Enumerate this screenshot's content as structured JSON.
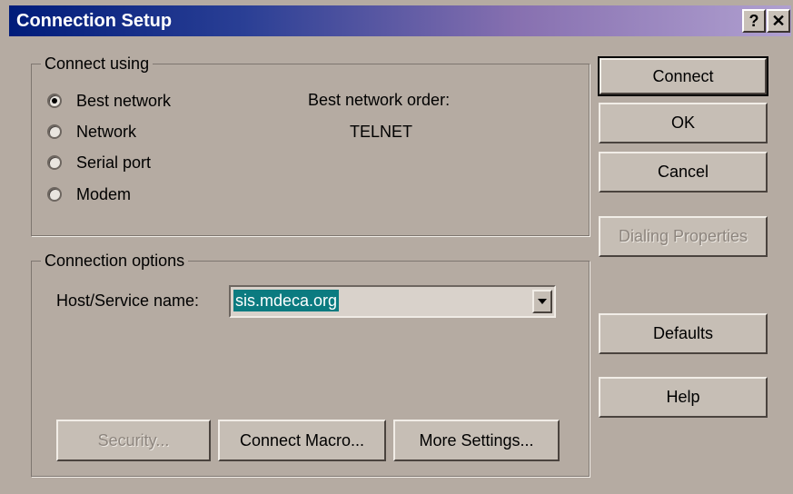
{
  "window": {
    "title": "Connection Setup"
  },
  "caption_buttons": {
    "help": "?",
    "close": "✕"
  },
  "connect_using": {
    "label": "Connect using",
    "options": [
      {
        "label": "Best network",
        "selected": true
      },
      {
        "label": "Network",
        "selected": false
      },
      {
        "label": "Serial port",
        "selected": false
      },
      {
        "label": "Modem",
        "selected": false
      }
    ],
    "order_label": "Best network order:",
    "order_value": "TELNET"
  },
  "connection_options": {
    "label": "Connection options",
    "host_label": "Host/Service name:",
    "host_value": "sis.mdeca.org"
  },
  "bottom_buttons": {
    "security": "Security...",
    "connect_macro": "Connect Macro...",
    "more_settings": "More Settings..."
  },
  "side_buttons": {
    "connect": "Connect",
    "ok": "OK",
    "cancel": "Cancel",
    "dialing_properties": "Dialing Properties",
    "defaults": "Defaults",
    "help": "Help"
  },
  "colors": {
    "title_gradient_start": "#001c7a",
    "title_gradient_end": "#b0a0d0",
    "dialog_bg": "#b5aba2",
    "selection": "#0b7b80"
  }
}
